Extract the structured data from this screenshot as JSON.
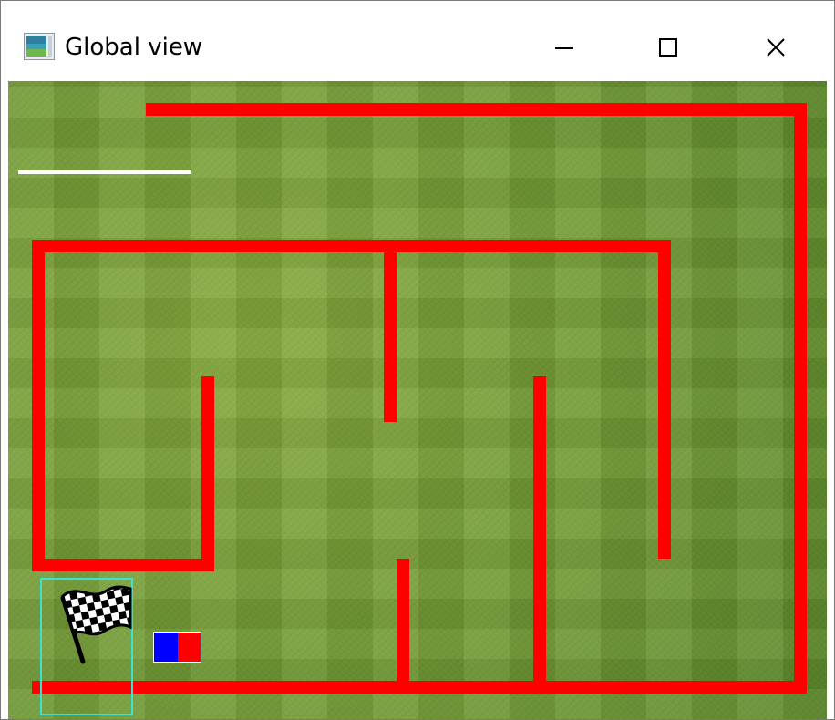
{
  "window": {
    "title": "Global view",
    "icon": "app-window-icon",
    "controls": [
      {
        "name": "minimize-button",
        "icon": "minimize-icon"
      },
      {
        "name": "maximize-button",
        "icon": "maximize-icon"
      },
      {
        "name": "close-button",
        "icon": "close-icon"
      }
    ]
  },
  "game": {
    "background": "grass",
    "wall_color": "#ff0000",
    "goal": {
      "icon": "checkered-flag-icon",
      "zone_color": "#40e0d0"
    },
    "player": {
      "left_color": "#0000ff",
      "right_color": "#ff0000"
    },
    "indicator_line_color": "#ffffff"
  }
}
